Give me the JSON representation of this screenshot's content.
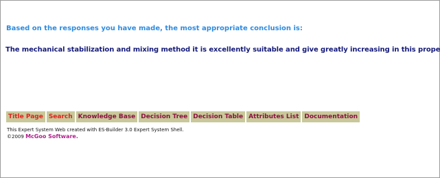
{
  "result": {
    "intro": "Based on the responses you have made, the most appropriate conclusion is:",
    "conclusion": "The mechanical stabilization and mixing method it is excellently suitable and give greatly increasing in this property ."
  },
  "nav": {
    "items": [
      {
        "label": "Title Page",
        "color": "#e4201c"
      },
      {
        "label": "Search",
        "color": "#e4201c"
      },
      {
        "label": "Knowledge Base",
        "color": "#8c1040"
      },
      {
        "label": "Decision Tree",
        "color": "#8c1040"
      },
      {
        "label": "Decision Table",
        "color": "#8c1040"
      },
      {
        "label": "Attributes List",
        "color": "#8c1040"
      },
      {
        "label": "Documentation",
        "color": "#8c1040"
      }
    ]
  },
  "footer": {
    "line1": "This Expert System Web created with ES-Builder 3.0 Expert System Shell.",
    "copyright": "©2009",
    "brand": "McGoo Software."
  }
}
